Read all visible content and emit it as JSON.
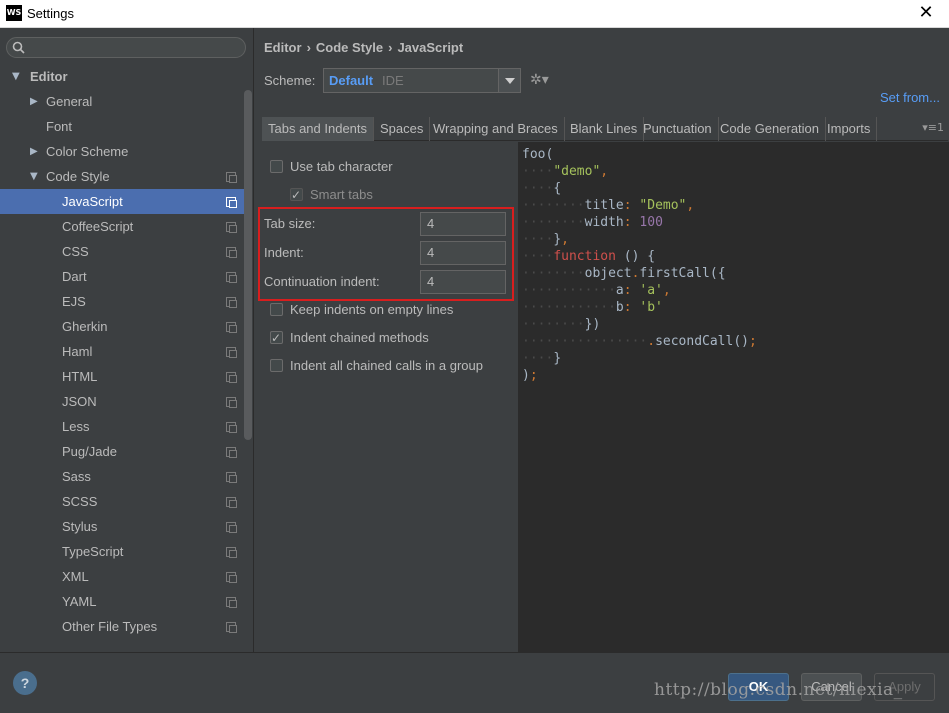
{
  "window": {
    "logo": "WS",
    "title": "Settings",
    "close": "✕"
  },
  "sidebar": {
    "items": [
      {
        "label": "Editor",
        "level": 0,
        "arrow": "▼",
        "bold": true
      },
      {
        "label": "General",
        "level": 1,
        "arrow": "▶"
      },
      {
        "label": "Font",
        "level": 1,
        "arrow": ""
      },
      {
        "label": "Color Scheme",
        "level": 1,
        "arrow": "▶"
      },
      {
        "label": "Code Style",
        "level": 1,
        "arrow": "▼",
        "copy": true
      },
      {
        "label": "JavaScript",
        "level": 2,
        "selected": true,
        "copy": true
      },
      {
        "label": "CoffeeScript",
        "level": 2,
        "copy": true
      },
      {
        "label": "CSS",
        "level": 2,
        "copy": true
      },
      {
        "label": "Dart",
        "level": 2,
        "copy": true
      },
      {
        "label": "EJS",
        "level": 2,
        "copy": true
      },
      {
        "label": "Gherkin",
        "level": 2,
        "copy": true
      },
      {
        "label": "Haml",
        "level": 2,
        "copy": true
      },
      {
        "label": "HTML",
        "level": 2,
        "copy": true
      },
      {
        "label": "JSON",
        "level": 2,
        "copy": true
      },
      {
        "label": "Less",
        "level": 2,
        "copy": true
      },
      {
        "label": "Pug/Jade",
        "level": 2,
        "copy": true
      },
      {
        "label": "Sass",
        "level": 2,
        "copy": true
      },
      {
        "label": "SCSS",
        "level": 2,
        "copy": true
      },
      {
        "label": "Stylus",
        "level": 2,
        "copy": true
      },
      {
        "label": "TypeScript",
        "level": 2,
        "copy": true
      },
      {
        "label": "XML",
        "level": 2,
        "copy": true
      },
      {
        "label": "YAML",
        "level": 2,
        "copy": true
      },
      {
        "label": "Other File Types",
        "level": 2,
        "copy": true
      }
    ]
  },
  "breadcrumb": [
    "Editor",
    "Code Style",
    "JavaScript"
  ],
  "breadcrumb_sep": "›",
  "scheme": {
    "label": "Scheme:",
    "value": "Default",
    "type": "IDE",
    "gear": "✲▾",
    "set_from": "Set from..."
  },
  "tabs": [
    "Tabs and Indents",
    "Spaces",
    "Wrapping and Braces",
    "Blank Lines",
    "Punctuation",
    "Code Generation",
    "Imports"
  ],
  "tabs_more": "▾≡1",
  "options": {
    "use_tab": {
      "label": "Use tab character",
      "checked": false
    },
    "smart_tabs": {
      "label": "Smart tabs",
      "checked": true,
      "disabled": true
    },
    "tab_size": {
      "label": "Tab size:",
      "value": "4"
    },
    "indent": {
      "label": "Indent:",
      "value": "4"
    },
    "continuation": {
      "label": "Continuation indent:",
      "value": "4"
    },
    "keep_indents": {
      "label": "Keep indents on empty lines",
      "checked": false
    },
    "indent_chained": {
      "label": "Indent chained methods",
      "checked": true
    },
    "indent_all_chained": {
      "label": "Indent all chained calls in a group",
      "checked": false
    }
  },
  "code_lines": [
    [
      [
        "foo(",
        ""
      ]
    ],
    [
      [
        "····",
        "ws"
      ],
      [
        "\"demo\"",
        "strg"
      ],
      [
        ",",
        "pun"
      ]
    ],
    [
      [
        "····",
        "ws"
      ],
      [
        "{",
        ""
      ]
    ],
    [
      [
        "········",
        "ws"
      ],
      [
        "title",
        ""
      ],
      [
        ":",
        "pun"
      ],
      [
        " ",
        ""
      ],
      [
        "\"Demo\"",
        "strg"
      ],
      [
        ",",
        "pun"
      ]
    ],
    [
      [
        "········",
        "ws"
      ],
      [
        "width",
        ""
      ],
      [
        ":",
        "pun"
      ],
      [
        " ",
        ""
      ],
      [
        "100",
        "prop"
      ]
    ],
    [
      [
        "····",
        "ws"
      ],
      [
        "}",
        ""
      ],
      [
        ",",
        "pun"
      ]
    ],
    [
      [
        "····",
        "ws"
      ],
      [
        "function",
        "red"
      ],
      [
        " () {",
        ""
      ]
    ],
    [
      [
        "········",
        "ws"
      ],
      [
        "object",
        ""
      ],
      [
        ".",
        "pun"
      ],
      [
        "firstCall({",
        ""
      ]
    ],
    [
      [
        "············",
        "ws"
      ],
      [
        "a",
        ""
      ],
      [
        ":",
        "pun"
      ],
      [
        " ",
        ""
      ],
      [
        "'a'",
        "strg"
      ],
      [
        ",",
        "pun"
      ]
    ],
    [
      [
        "············",
        "ws"
      ],
      [
        "b",
        ""
      ],
      [
        ":",
        "pun"
      ],
      [
        " ",
        ""
      ],
      [
        "'b'",
        "strg"
      ]
    ],
    [
      [
        "········",
        "ws"
      ],
      [
        "})",
        ""
      ]
    ],
    [
      [
        "················",
        "ws"
      ],
      [
        ".",
        "pun"
      ],
      [
        "secondCall()",
        ""
      ],
      [
        ";",
        "pun"
      ]
    ],
    [
      [
        "····",
        "ws"
      ],
      [
        "}",
        ""
      ]
    ],
    [
      [
        ")",
        ""
      ],
      [
        ";",
        "pun"
      ]
    ]
  ],
  "footer": {
    "help": "?",
    "ok": "OK",
    "cancel": "Cancel",
    "apply": "Apply"
  },
  "watermark": "http://blog.csdn.net/niexia_"
}
